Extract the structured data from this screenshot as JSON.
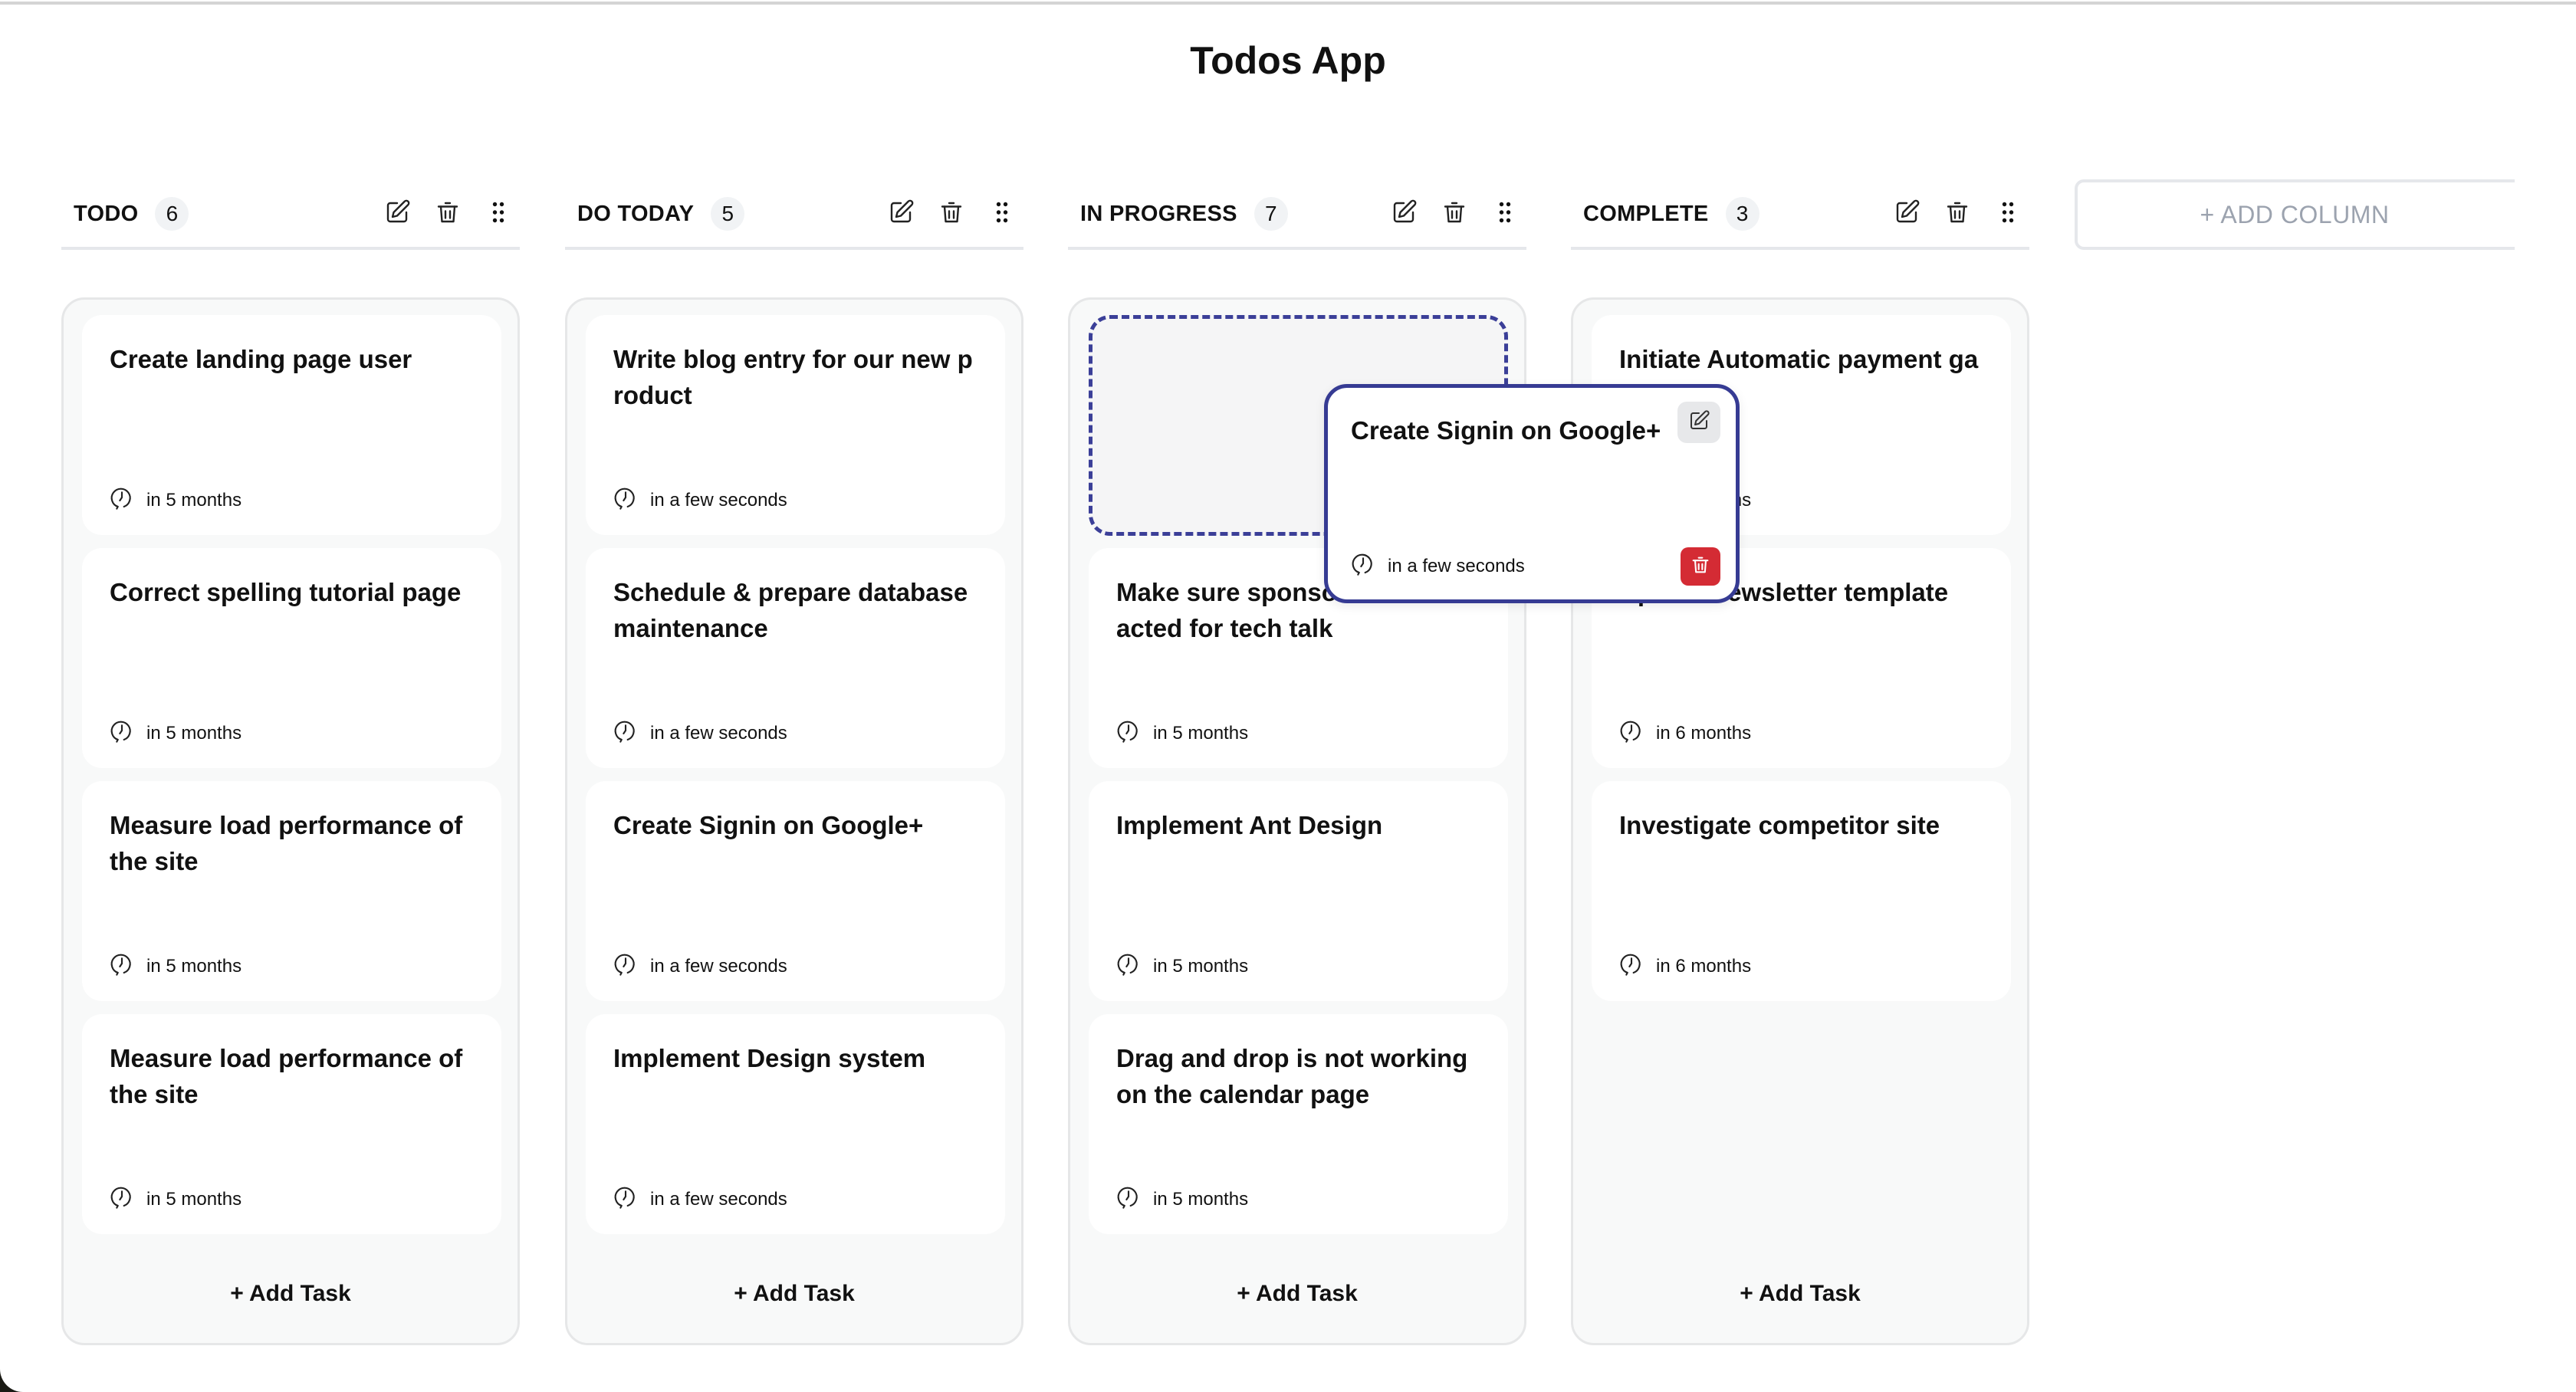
{
  "app": {
    "title": "Todos App"
  },
  "add_column_label": "+ ADD COLUMN",
  "add_task_label": "+ Add Task",
  "colors": {
    "accent": "#363b93",
    "danger": "#d42b34",
    "column_bg": "#f8f9f9",
    "muted": "#9ca3af"
  },
  "columns": [
    {
      "name": "TODO",
      "count": "6",
      "cards": [
        {
          "title": "Create landing page user",
          "due": "in 5 months"
        },
        {
          "title": "Correct spelling tutorial page",
          "due": "in 5 months"
        },
        {
          "title": "Measure load performance of the site",
          "due": "in 5 months"
        },
        {
          "title": "Measure load performance of the site",
          "due": "in 5 months"
        }
      ]
    },
    {
      "name": "DO TODAY",
      "count": "5",
      "cards": [
        {
          "title": "Write blog entry for our new product",
          "due": "in a few seconds"
        },
        {
          "title": "Schedule & prepare database maintenance",
          "due": "in a few seconds"
        },
        {
          "title": "Create Signin on Google+",
          "due": "in a few seconds"
        },
        {
          "title": "Implement Design system",
          "due": "in a few seconds"
        }
      ]
    },
    {
      "name": "IN PROGRESS",
      "count": "7",
      "cards": [
        {
          "title": "Make sure sponsors are contacted for tech talk",
          "due": "in 5 months"
        },
        {
          "title": "Implement Ant Design",
          "due": "in 5 months"
        },
        {
          "title": "Drag and drop is not working on the calendar page",
          "due": "in 5 months"
        }
      ]
    },
    {
      "name": "COMPLETE",
      "count": "3",
      "cards": [
        {
          "title": "Initiate Automatic payment gateway",
          "due": "in 6 months"
        },
        {
          "title": "Update newsletter template",
          "due": "in 6 months"
        },
        {
          "title": "Investigate competitor site",
          "due": "in 6 months"
        }
      ]
    }
  ],
  "dragging_card": {
    "title": "Create Signin on Google+",
    "due": "in a few seconds"
  },
  "icons": {
    "edit": "edit-icon",
    "delete": "trash-icon",
    "drag": "drag-handle-icon",
    "clock": "clock-icon"
  }
}
